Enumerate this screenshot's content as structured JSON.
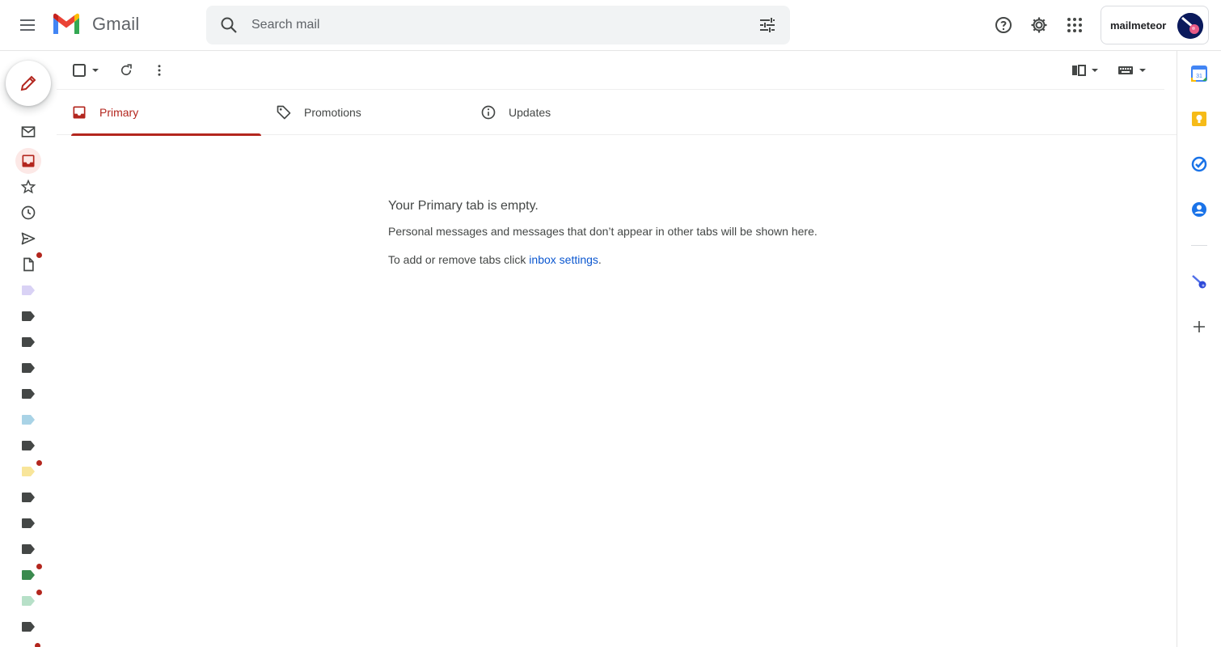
{
  "app": {
    "name": "Gmail"
  },
  "header": {
    "search_placeholder": "Search mail",
    "icons": [
      "menu-icon",
      "search-icon",
      "filter-icon",
      "help-icon",
      "settings-icon",
      "apps-icon"
    ],
    "account_name": "mailmeteor"
  },
  "tabs": [
    {
      "label": "Primary",
      "icon": "inbox-icon",
      "active": true
    },
    {
      "label": "Promotions",
      "icon": "tag-icon",
      "active": false
    },
    {
      "label": "Updates",
      "icon": "info-icon",
      "active": false
    }
  ],
  "empty_state": {
    "title": "Your Primary tab is empty.",
    "line1": "Personal messages and messages that don’t appear in other tabs will be shown here.",
    "line2_prefix": "To add or remove tabs click ",
    "line2_link": "inbox settings",
    "line2_suffix": "."
  },
  "colors": {
    "accent": "#b3261e",
    "link": "#0b57d0",
    "label_colors": [
      "#d9d2f5",
      "#444746",
      "#444746",
      "#444746",
      "#444746",
      "#a9d3e6",
      "#444746",
      "#f8e59a",
      "#444746",
      "#444746",
      "#444746",
      "#3a8a4e",
      "#b7e0c8",
      "#444746"
    ]
  },
  "rail": {
    "items": [
      "all-mail-icon",
      "inbox-icon",
      "star-icon",
      "clock-icon",
      "send-icon",
      "draft-icon"
    ]
  }
}
